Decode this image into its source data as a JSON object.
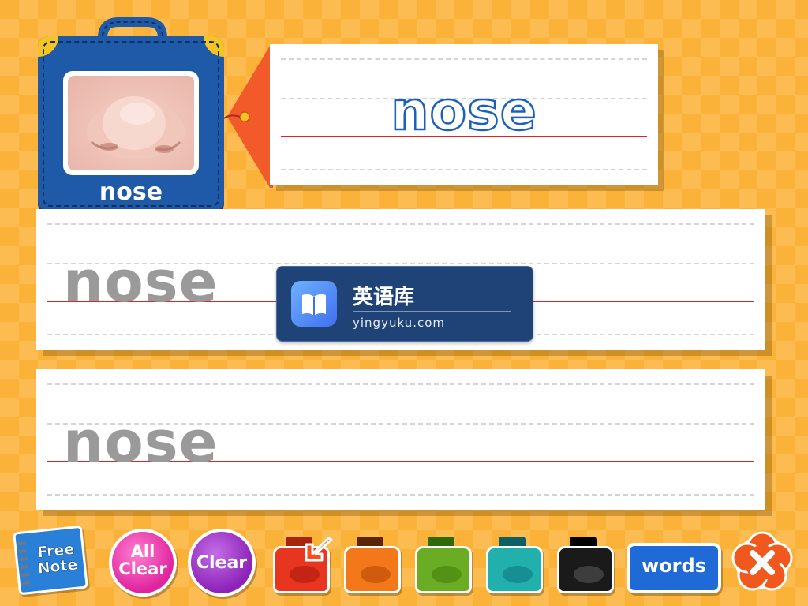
{
  "word_card": {
    "image": "nose-photo",
    "label": "nose"
  },
  "model": {
    "word": "nose"
  },
  "practice": [
    {
      "trace_word": "nose"
    },
    {
      "trace_word": "nose"
    }
  ],
  "watermark": {
    "icon": "book-icon",
    "title": "英语库",
    "site": "yingyuku.com"
  },
  "toolbar": {
    "free_note": {
      "line1": "Free",
      "line2": "Note"
    },
    "all_clear": {
      "line1": "All",
      "line2": "Clear"
    },
    "clear": "Clear",
    "inks": [
      {
        "name": "red",
        "color": "#e8351f",
        "selected": true
      },
      {
        "name": "brown",
        "color": "#8a3a12",
        "selected": false
      },
      {
        "name": "green",
        "color": "#5e9e1c",
        "selected": false
      },
      {
        "name": "teal",
        "color": "#1aa0a0",
        "selected": false
      },
      {
        "name": "black",
        "color": "#1a1a1a",
        "selected": false
      }
    ],
    "words": "words",
    "close_icon": "close-icon"
  },
  "colors": {
    "background": "#fbb238",
    "card_blue": "#1e5aa8",
    "tag_red": "#f25a2a",
    "model_outline": "#1b60bd",
    "guide_red": "#e3231f"
  }
}
